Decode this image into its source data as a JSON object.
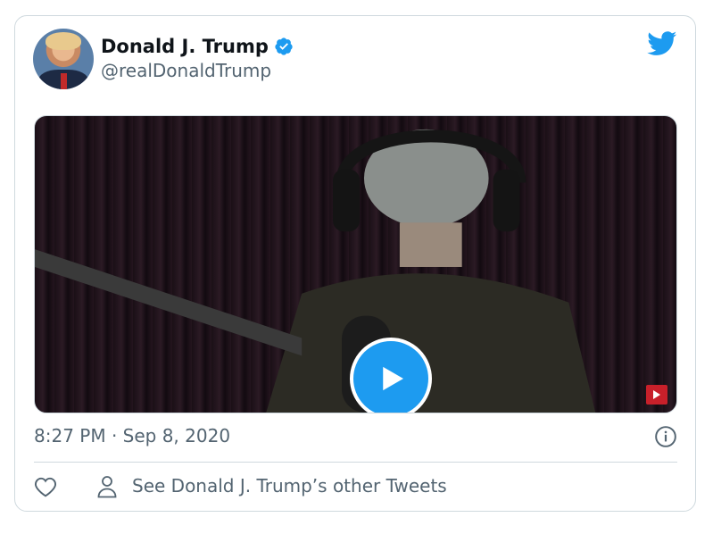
{
  "tweet": {
    "author_name": "Donald J. Trump",
    "author_handle": "@realDonaldTrump",
    "timestamp": "8:27 PM · Sep 8, 2020",
    "other_tweets_label": "See Donald J. Trump’s other Tweets"
  },
  "icons": {
    "verified": "verified-badge-icon",
    "brand": "twitter-bird-icon",
    "play": "play-icon",
    "info": "info-icon",
    "like": "heart-icon",
    "profile": "person-icon",
    "subscribe": "youtube-subscribe-icon"
  },
  "colors": {
    "accent": "#1d9bf0",
    "text_primary": "#0f1419",
    "text_secondary": "#536471",
    "border": "#cfd9de"
  }
}
